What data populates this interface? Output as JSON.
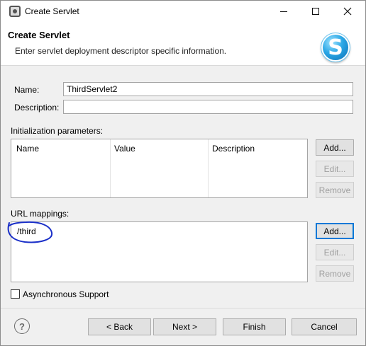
{
  "window": {
    "title": "Create Servlet"
  },
  "header": {
    "title": "Create Servlet",
    "description": "Enter servlet deployment descriptor specific information.",
    "logo_letter": "S"
  },
  "form": {
    "name_label": "Name:",
    "name_value": "ThirdServlet2",
    "description_label": "Description:",
    "description_value": ""
  },
  "init_params": {
    "label": "Initialization parameters:",
    "columns": [
      "Name",
      "Value",
      "Description"
    ],
    "add_label": "Add...",
    "edit_label": "Edit...",
    "remove_label": "Remove"
  },
  "url_mappings": {
    "label": "URL mappings:",
    "items": [
      "/third"
    ],
    "add_label": "Add...",
    "edit_label": "Edit...",
    "remove_label": "Remove"
  },
  "async": {
    "label": "Asynchronous Support",
    "checked": false
  },
  "footer": {
    "help_icon": "?",
    "back_label": "< Back",
    "next_label": "Next >",
    "finish_label": "Finish",
    "cancel_label": "Cancel"
  },
  "colors": {
    "annotation": "#1a2fc8",
    "focus": "#0078d7"
  }
}
